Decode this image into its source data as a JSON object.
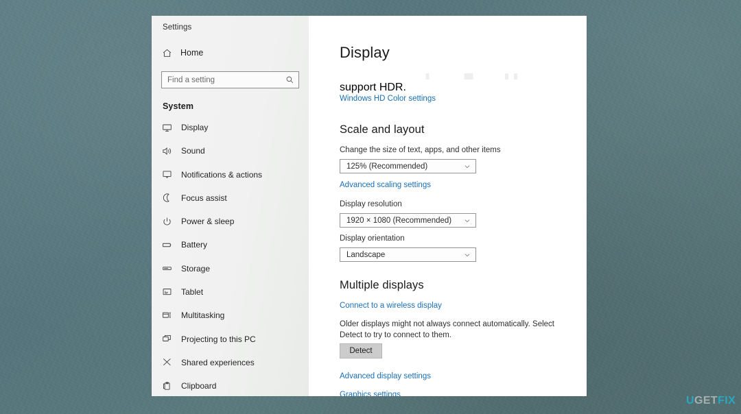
{
  "desktop": {
    "background_color": "#5a7a7e"
  },
  "window": {
    "title": "Settings",
    "home_label": "Home",
    "home_icon": "home-icon"
  },
  "search": {
    "placeholder": "Find a setting",
    "value": "",
    "icon": "search-icon"
  },
  "sidebar": {
    "group_title": "System",
    "items": [
      {
        "label": "Display",
        "icon": "monitor-icon"
      },
      {
        "label": "Sound",
        "icon": "speaker-icon"
      },
      {
        "label": "Notifications & actions",
        "icon": "notification-icon"
      },
      {
        "label": "Focus assist",
        "icon": "moon-icon"
      },
      {
        "label": "Power & sleep",
        "icon": "power-icon"
      },
      {
        "label": "Battery",
        "icon": "battery-icon"
      },
      {
        "label": "Storage",
        "icon": "storage-icon"
      },
      {
        "label": "Tablet",
        "icon": "tablet-icon"
      },
      {
        "label": "Multitasking",
        "icon": "multitasking-icon"
      },
      {
        "label": "Projecting to this PC",
        "icon": "project-icon"
      },
      {
        "label": "Shared experiences",
        "icon": "share-icon"
      },
      {
        "label": "Clipboard",
        "icon": "clipboard-icon"
      }
    ]
  },
  "main": {
    "page_title": "Display",
    "hdr_text": "support HDR.",
    "hd_color_link": "Windows HD Color settings",
    "scale_section": {
      "heading": "Scale and layout",
      "scale_label": "Change the size of text, apps, and other items",
      "scale_value": "125% (Recommended)",
      "advanced_scaling_link": "Advanced scaling settings",
      "resolution_label": "Display resolution",
      "resolution_value": "1920 × 1080 (Recommended)",
      "orientation_label": "Display orientation",
      "orientation_value": "Landscape"
    },
    "multiple_displays": {
      "heading": "Multiple displays",
      "wireless_link": "Connect to a wireless display",
      "description": "Older displays might not always connect automatically. Select Detect to try to connect to them.",
      "detect_button": "Detect"
    },
    "footer_links": {
      "advanced_display": "Advanced display settings",
      "graphics": "Graphics settings"
    }
  },
  "watermark": {
    "part1": "U",
    "part2": "GET",
    "part3": "FIX",
    "accent_color": "#1fb6d8",
    "neutral_color": "#b9c0c0"
  }
}
